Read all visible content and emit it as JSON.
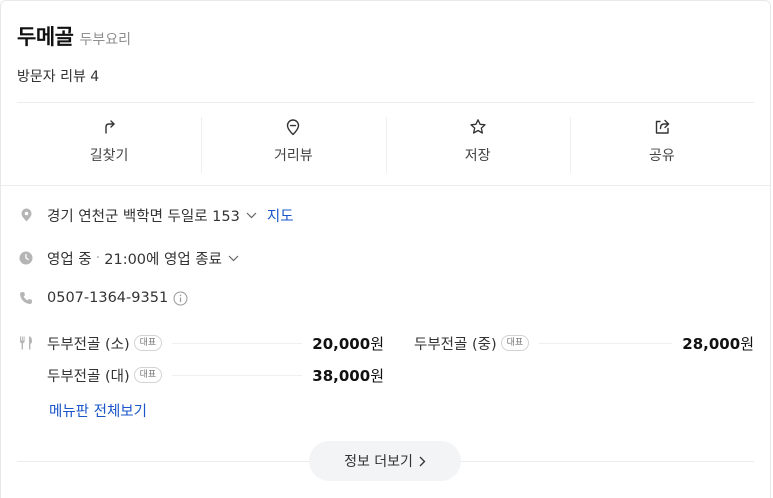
{
  "place": {
    "name": "두메골",
    "category": "두부요리",
    "review": "방문자 리뷰 4"
  },
  "actions": [
    {
      "label": "길찾기",
      "icon": "directions-arrow-icon"
    },
    {
      "label": "거리뷰",
      "icon": "map-pin-icon"
    },
    {
      "label": "저장",
      "icon": "star-icon"
    },
    {
      "label": "공유",
      "icon": "share-icon"
    }
  ],
  "info": {
    "address": "경기 연천군 백학면 두일로 153",
    "map_link": "지도",
    "status": "영업 중",
    "hours_end": "21:00에 영업 종료",
    "phone": "0507-1364-9351"
  },
  "menu": {
    "items": [
      {
        "name": "두부전골 (소)",
        "badge": "대표",
        "price": "20,000",
        "unit": "원"
      },
      {
        "name": "두부전골 (중)",
        "badge": "대표",
        "price": "28,000",
        "unit": "원"
      },
      {
        "name": "두부전골 (대)",
        "badge": "대표",
        "price": "38,000",
        "unit": "원"
      }
    ],
    "full_link": "메뉴판 전체보기"
  },
  "more_button": "정보 더보기",
  "colors": {
    "link": "#1a56c9",
    "icon_gray": "#b5b5b5",
    "divider": "#ececec"
  }
}
